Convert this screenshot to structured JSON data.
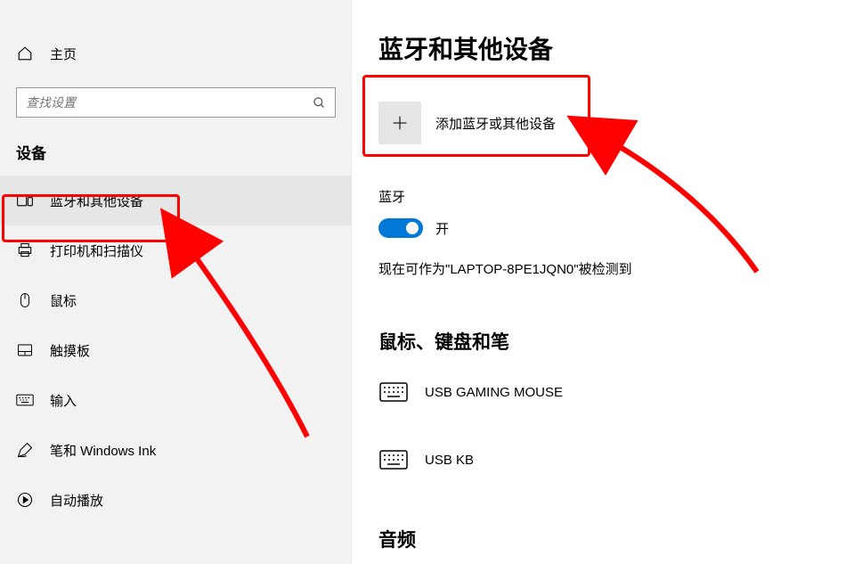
{
  "sidebar": {
    "home": "主页",
    "search_placeholder": "查找设置",
    "section": "设备",
    "items": [
      {
        "label": "蓝牙和其他设备",
        "icon": "bluetooth-devices-icon",
        "selected": true
      },
      {
        "label": "打印机和扫描仪",
        "icon": "printer-icon",
        "selected": false
      },
      {
        "label": "鼠标",
        "icon": "mouse-icon",
        "selected": false
      },
      {
        "label": "触摸板",
        "icon": "touchpad-icon",
        "selected": false
      },
      {
        "label": "输入",
        "icon": "keyboard-icon",
        "selected": false
      },
      {
        "label": "笔和 Windows Ink",
        "icon": "pen-icon",
        "selected": false
      },
      {
        "label": "自动播放",
        "icon": "autoplay-icon",
        "selected": false
      }
    ]
  },
  "content": {
    "title": "蓝牙和其他设备",
    "add_device": "添加蓝牙或其他设备",
    "bt_label": "蓝牙",
    "toggle_state": "开",
    "toggle_on": true,
    "discover_text": "现在可作为\"LAPTOP-8PE1JQN0\"被检测到",
    "section_mouse_kb": "鼠标、键盘和笔",
    "devices": [
      {
        "label": "USB GAMING MOUSE",
        "icon": "keyboard-device-icon"
      },
      {
        "label": "USB KB",
        "icon": "keyboard-device-icon"
      }
    ],
    "section_audio": "音频"
  },
  "annotations": {
    "highlight_color": "#ff0000"
  }
}
